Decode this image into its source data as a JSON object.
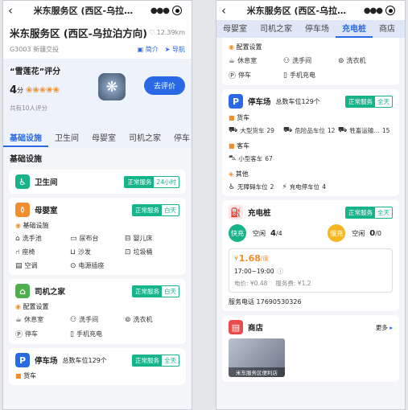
{
  "left": {
    "header": {
      "title": "米东服务区 (西区-乌拉…",
      "back_icon": "‹"
    },
    "info": {
      "name": "米东服务区 (西区-乌拉泊方向)",
      "distance": "12.39km",
      "road": "G3003 新疆交投",
      "intro_label": "简介",
      "nav_label": "导航"
    },
    "rating": {
      "title": "“雪莲花”评分",
      "score": "4",
      "score_unit": "分",
      "count": "共有10人评分",
      "rate_btn": "去评价"
    },
    "tabs": [
      "基础设施",
      "卫生间",
      "母婴室",
      "司机之家",
      "停车"
    ],
    "section_title": "基础设施",
    "toilet": {
      "name": "卫生间",
      "status": "正常服务",
      "hours": "24小时"
    },
    "baby": {
      "name": "母婴室",
      "status": "正常服务",
      "hours": "白天",
      "sub": "基础设施",
      "items": [
        "洗手池",
        "尿布台",
        "婴儿床",
        "座椅",
        "沙发",
        "垃圾桶",
        "空调",
        "电源插座"
      ]
    },
    "driver": {
      "name": "司机之家",
      "status": "正常服务",
      "hours": "白天",
      "sub": "配置设置",
      "items": [
        "休息室",
        "洗手间",
        "洗衣机",
        "停车",
        "手机充电"
      ]
    },
    "parking": {
      "name": "停车场",
      "total": "总数车位129个",
      "status": "正常服务",
      "hours": "全天",
      "sub": "货车"
    }
  },
  "right": {
    "header": {
      "title": "米东服务区 (西区-乌拉…",
      "back_icon": "‹"
    },
    "tabs": [
      "母婴室",
      "司机之家",
      "停车场",
      "充电桩",
      "商店"
    ],
    "active_tab": "充电桩",
    "driver": {
      "sub": "配置设置",
      "items": [
        "休息室",
        "洗手间",
        "洗衣机",
        "停车",
        "手机充电"
      ]
    },
    "parking": {
      "name": "停车场",
      "total": "总数车位129个",
      "status": "正常服务",
      "hours": "全天",
      "truck": "货车",
      "truck_items": [
        {
          "label": "大型货车",
          "value": "29"
        },
        {
          "label": "危险品车位",
          "value": "12"
        },
        {
          "label": "牲畜运输…",
          "value": "15"
        }
      ],
      "bus": "客车",
      "bus_items": [
        {
          "label": "小型客车",
          "value": "67"
        }
      ],
      "other": "其他",
      "other_items": [
        {
          "label": "无障碍车位",
          "value": "2"
        },
        {
          "label": "充电停车位",
          "value": "4"
        }
      ]
    },
    "charging": {
      "name": "充电桩",
      "status": "正常服务",
      "hours": "全天",
      "fast_label": "快充",
      "fast_free_label": "空闲",
      "fast_free": "4",
      "fast_total": "/4",
      "slow_label": "慢充",
      "slow_free_label": "空闲",
      "slow_free": "0",
      "slow_total": "/0",
      "price_sym": "¥",
      "price": "1.68",
      "price_unit": "/度",
      "time": "17:00~19:00",
      "fee_elec": "电价: ¥0.48",
      "fee_service": "服务费: ¥1.2",
      "phone": "服务电话 17690530326"
    },
    "shop": {
      "name": "商店",
      "more": "更多",
      "img_caption": "米东服务区便利店"
    }
  },
  "colors": {
    "accent": "#2a69e6",
    "green": "#17b389",
    "orange": "#f08d2c"
  }
}
